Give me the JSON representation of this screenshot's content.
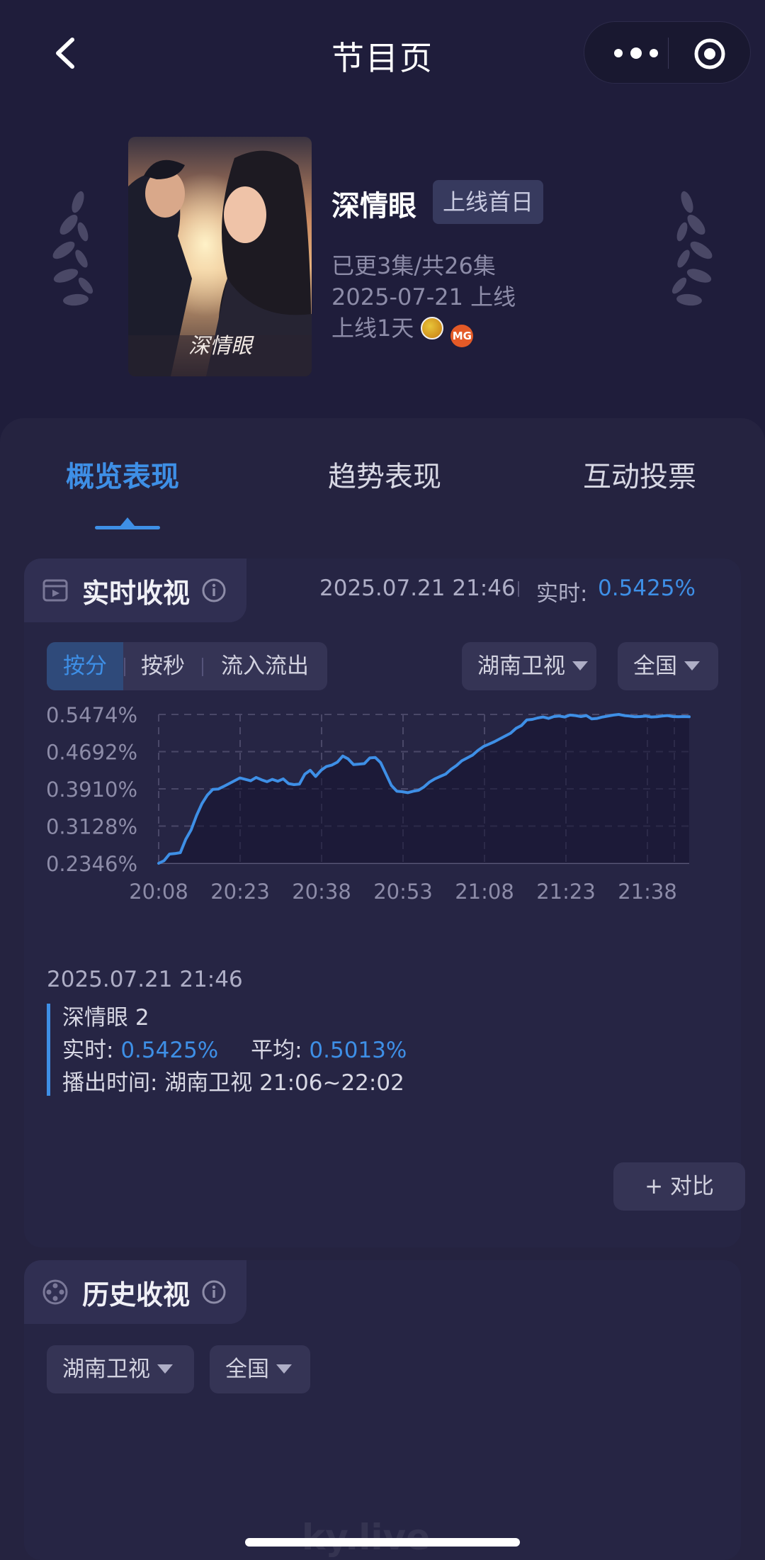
{
  "nav": {
    "title": "节目页"
  },
  "show": {
    "title": "深情眼",
    "badge": "上线首日",
    "episodes": "已更3集/共26集",
    "release": "2025-07-21 上线",
    "days_online": "上线1天",
    "poster_title": "深情眼",
    "mgtv_label": "MG"
  },
  "tabs": [
    {
      "label": "概览表现",
      "active": true
    },
    {
      "label": "趋势表现",
      "active": false
    },
    {
      "label": "互动投票",
      "active": false
    }
  ],
  "realtime": {
    "title": "实时收视",
    "time": "2025.07.21 21:46",
    "label": "实时:",
    "value": "0.5425%",
    "segments": [
      "按分",
      "按秒",
      "流入流出"
    ],
    "channel": "湖南卫视",
    "region": "全国",
    "detail": {
      "time": "2025.07.21 21:46",
      "name": "深情眼 2",
      "realtime_label": "实时:",
      "realtime_value": "0.5425%",
      "avg_label": "平均:",
      "avg_value": "0.5013%",
      "broadcast": "播出时间:  湖南卫视 21:06~22:02"
    },
    "compare": "+ 对比"
  },
  "history": {
    "title": "历史收视",
    "channel": "湖南卫视",
    "region": "全国"
  },
  "watermark": "ky.live",
  "colors": {
    "accent": "#3e8fe6",
    "background": "#1f1d3b",
    "panel": "#252340"
  },
  "chart_data": {
    "type": "line",
    "y_ticks": [
      "0.5474%",
      "0.4692%",
      "0.3910%",
      "0.3128%",
      "0.2346%"
    ],
    "x_ticks": [
      "20:08",
      "20:23",
      "20:38",
      "20:53",
      "21:08",
      "21:23",
      "21:38"
    ],
    "ylim": [
      0.2346,
      0.5474
    ],
    "xlim_minutes": [
      0,
      98
    ],
    "grid": true,
    "series": [
      {
        "color": "#3e8fe6",
        "x": [
          0,
          1,
          2,
          3,
          4,
          5,
          6,
          7,
          8,
          9,
          10,
          11,
          12,
          13,
          14,
          15,
          16,
          17,
          18,
          19,
          20,
          21,
          22,
          23,
          24,
          25,
          26,
          27,
          28,
          29,
          30,
          31,
          32,
          33,
          34,
          35,
          36,
          37,
          38,
          39,
          40,
          41,
          42,
          43,
          44,
          45,
          46,
          47,
          48,
          49,
          50,
          51,
          52,
          53,
          54,
          55,
          56,
          57,
          58,
          59,
          60,
          61,
          62,
          63,
          64,
          65,
          66,
          67,
          68,
          69,
          70,
          71,
          72,
          73,
          74,
          75,
          76,
          77,
          78,
          79,
          80,
          81,
          82,
          83,
          84,
          85,
          86,
          87,
          88,
          89,
          90,
          91,
          92,
          93,
          94,
          95,
          96,
          97,
          98
        ],
        "y": [
          0.2346,
          0.24,
          0.254,
          0.255,
          0.257,
          0.285,
          0.305,
          0.335,
          0.36,
          0.378,
          0.39,
          0.3905,
          0.396,
          0.402,
          0.408,
          0.414,
          0.411,
          0.408,
          0.415,
          0.41,
          0.406,
          0.411,
          0.407,
          0.412,
          0.402,
          0.4,
          0.401,
          0.422,
          0.43,
          0.417,
          0.43,
          0.438,
          0.441,
          0.447,
          0.46,
          0.454,
          0.442,
          0.443,
          0.444,
          0.456,
          0.457,
          0.446,
          0.422,
          0.398,
          0.386,
          0.385,
          0.383,
          0.386,
          0.388,
          0.395,
          0.405,
          0.412,
          0.417,
          0.422,
          0.432,
          0.44,
          0.45,
          0.456,
          0.462,
          0.472,
          0.48,
          0.485,
          0.49,
          0.496,
          0.502,
          0.508,
          0.518,
          0.524,
          0.536,
          0.537,
          0.54,
          0.542,
          0.539,
          0.543,
          0.544,
          0.542,
          0.546,
          0.545,
          0.543,
          0.545,
          0.538,
          0.539,
          0.542,
          0.544,
          0.546,
          0.5474,
          0.545,
          0.544,
          0.5425,
          0.543,
          0.544,
          0.542,
          0.5425,
          0.544,
          0.545,
          0.543,
          0.5425,
          0.543,
          0.5425
        ]
      }
    ]
  }
}
